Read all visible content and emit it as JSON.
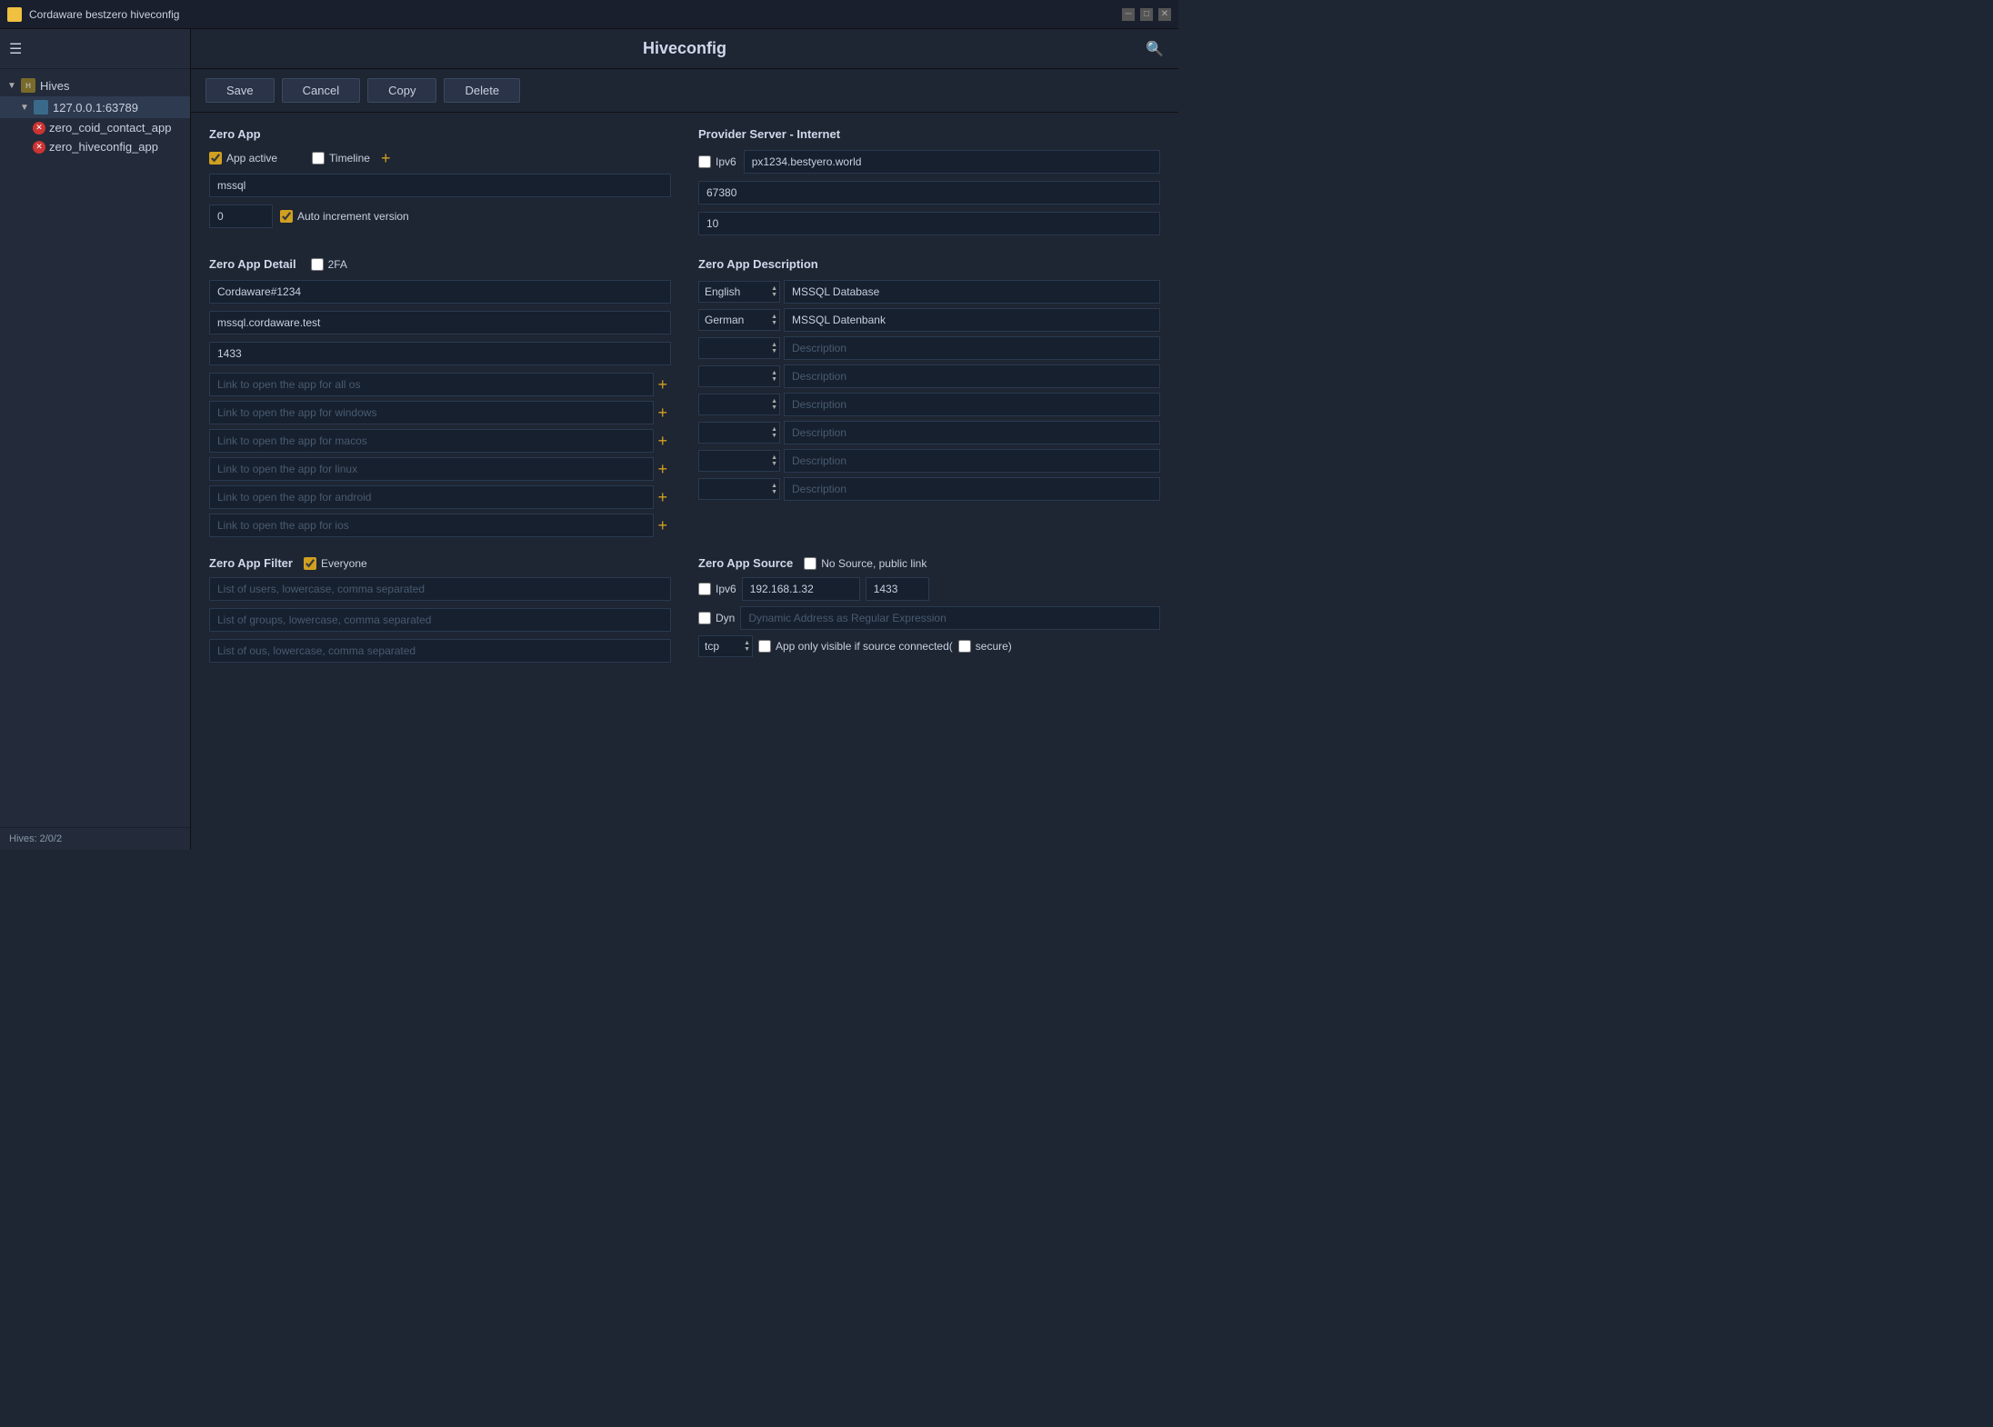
{
  "titlebar": {
    "title": "Cordaware bestzero hiveconfig",
    "controls": [
      "minimize",
      "restore",
      "close"
    ]
  },
  "sidebar": {
    "hamburger": "☰",
    "tree": {
      "hives_label": "Hives",
      "server_label": "127.0.0.1:63789",
      "apps": [
        {
          "label": "zero_coid_contact_app",
          "error": true
        },
        {
          "label": "zero_hiveconfig_app",
          "error": true
        }
      ]
    },
    "footer": "Hives: 2/0/2"
  },
  "header": {
    "title": "Hiveconfig",
    "search_icon": "🔍"
  },
  "toolbar": {
    "save": "Save",
    "cancel": "Cancel",
    "copy": "Copy",
    "delete": "Delete"
  },
  "zero_app": {
    "section_title": "Zero App",
    "app_active_label": "App active",
    "app_active_checked": true,
    "timeline_label": "Timeline",
    "timeline_checked": false,
    "app_name_value": "mssql",
    "version_value": "0",
    "auto_increment_label": "Auto increment version",
    "auto_increment_checked": true
  },
  "zero_app_detail": {
    "section_title": "Zero App Detail",
    "twofa_label": "2FA",
    "twofa_checked": false,
    "name_value": "Cordaware#1234",
    "host_value": "mssql.cordaware.test",
    "port_value": "1433",
    "links": [
      {
        "placeholder": "Link to open the app for all os"
      },
      {
        "placeholder": "Link to open the app for windows"
      },
      {
        "placeholder": "Link to open the app for macos"
      },
      {
        "placeholder": "Link to open the app for linux"
      },
      {
        "placeholder": "Link to open the app for android"
      },
      {
        "placeholder": "Link to open the app for ios"
      }
    ]
  },
  "provider_server": {
    "section_title": "Provider Server - Internet",
    "ipv6_label": "Ipv6",
    "ipv6_checked": false,
    "hostname_value": "px1234.bestyero.world",
    "port_value": "67380",
    "extra_value": "10"
  },
  "zero_app_description": {
    "section_title": "Zero App Description",
    "descriptions": [
      {
        "lang": "English",
        "text": "MSSQL Database"
      },
      {
        "lang": "German",
        "text": "MSSQL Datenbank"
      },
      {
        "lang": "",
        "placeholder": "Description"
      },
      {
        "lang": "",
        "placeholder": "Description"
      },
      {
        "lang": "",
        "placeholder": "Description"
      },
      {
        "lang": "",
        "placeholder": "Description"
      },
      {
        "lang": "",
        "placeholder": "Description"
      },
      {
        "lang": "",
        "placeholder": "Description"
      }
    ]
  },
  "zero_app_filter": {
    "section_title": "Zero App Filter",
    "everyone_label": "Everyone",
    "everyone_checked": true,
    "users_placeholder": "List of users, lowercase, comma separated",
    "groups_placeholder": "List of groups, lowercase, comma separated",
    "ous_placeholder": "List of ous, lowercase, comma separated"
  },
  "zero_app_source": {
    "section_title": "Zero App Source",
    "no_source_label": "No Source, public link",
    "no_source_checked": false,
    "ipv6_label": "Ipv6",
    "ipv6_checked": false,
    "ip_value": "192.168.1.32",
    "port_value": "1433",
    "dyn_label": "Dyn",
    "dyn_checked": false,
    "dyn_placeholder": "Dynamic Address as Regular Expression",
    "protocol_value": "tcp",
    "app_visible_label": "App only visible if source connected(",
    "secure_label": "secure)",
    "secure_checked": false
  }
}
